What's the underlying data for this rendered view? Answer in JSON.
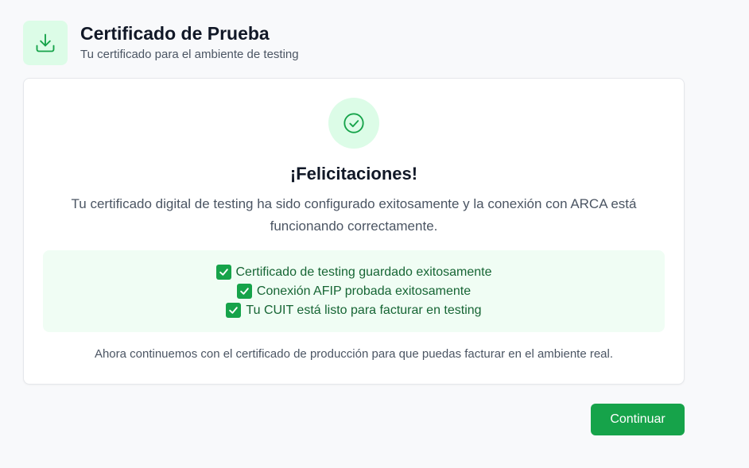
{
  "header": {
    "icon": "download-icon",
    "title": "Certificado de Prueba",
    "subtitle": "Tu certificado para el ambiente de testing"
  },
  "card": {
    "status_icon": "check-circle-icon",
    "heading": "¡Felicitaciones!",
    "message": "Tu certificado digital de testing ha sido configurado exitosamente y la conexión con ARCA está funcionando correctamente.",
    "checklist": [
      "Certificado de testing guardado exitosamente",
      "Conexión AFIP probada exitosamente",
      "Tu CUIT está listo para facturar en testing"
    ],
    "checklist_icon": "check-mark-button-icon",
    "footer_note": "Ahora continuemos con el certificado de producción para que puedas facturar en el ambiente real."
  },
  "actions": {
    "continue_label": "Continuar"
  },
  "colors": {
    "accent": "#16a34a",
    "accent_light": "#dcfce7",
    "checklist_bg": "#f0fdf4",
    "checklist_text": "#166534"
  }
}
